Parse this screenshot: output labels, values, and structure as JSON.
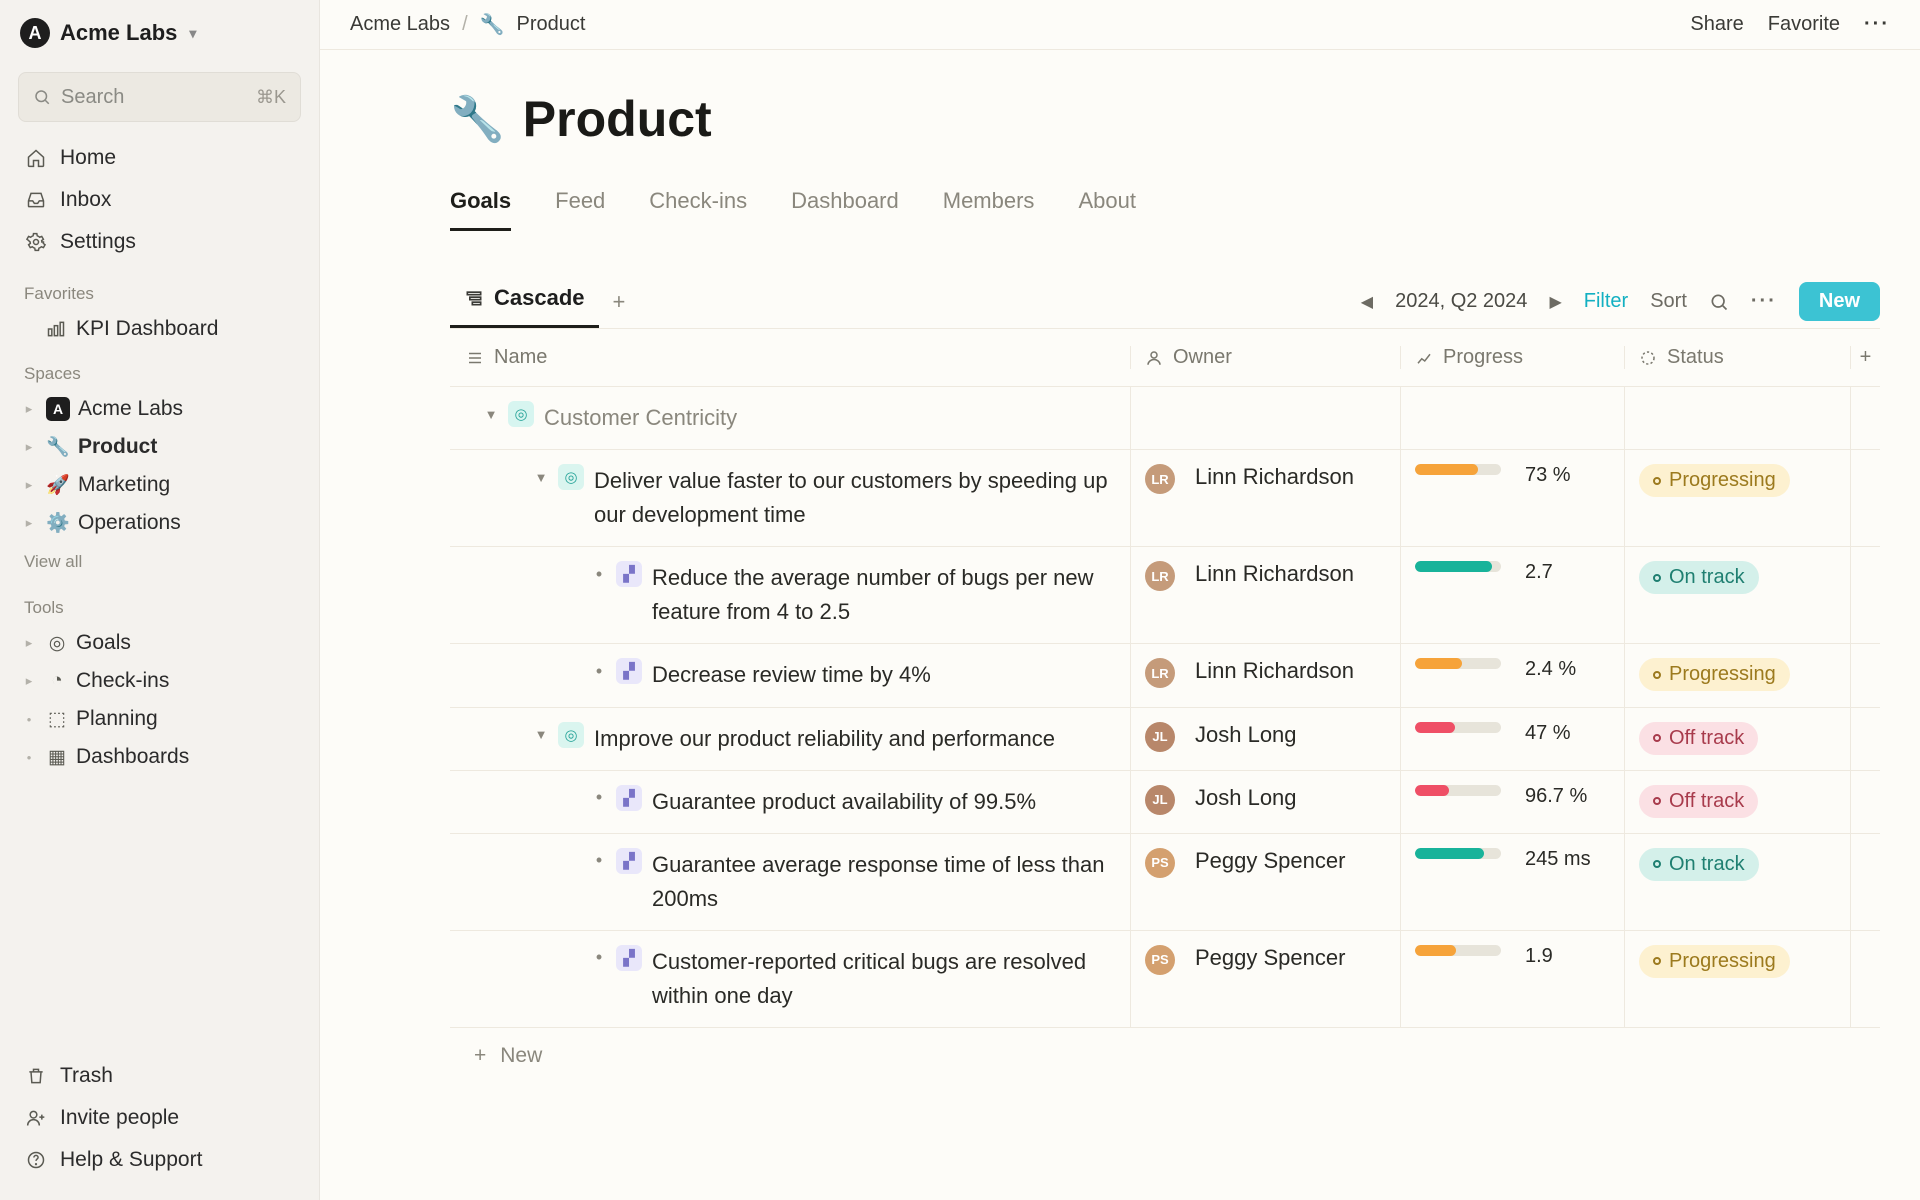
{
  "workspace": {
    "name": "Acme Labs"
  },
  "search": {
    "placeholder": "Search",
    "shortcut": "⌘K"
  },
  "nav": {
    "home": "Home",
    "inbox": "Inbox",
    "settings": "Settings"
  },
  "sections": {
    "favorites": "Favorites",
    "spaces": "Spaces",
    "tools": "Tools"
  },
  "favorites": [
    {
      "label": "KPI Dashboard",
      "icon": "chart"
    }
  ],
  "spaces": [
    {
      "label": "Acme Labs",
      "icon": "logo",
      "bold": false
    },
    {
      "label": "Product",
      "icon": "🔧",
      "bold": true
    },
    {
      "label": "Marketing",
      "icon": "🚀",
      "bold": false
    },
    {
      "label": "Operations",
      "icon": "⚙️",
      "bold": false
    }
  ],
  "viewall": "View all",
  "tools": [
    {
      "label": "Goals",
      "icon": "◎",
      "caret": true
    },
    {
      "label": "Check-ins",
      "icon": "◔",
      "caret": true
    },
    {
      "label": "Planning",
      "icon": "⬚",
      "caret": false
    },
    {
      "label": "Dashboards",
      "icon": "▦",
      "caret": false
    }
  ],
  "bottom": {
    "trash": "Trash",
    "invite": "Invite people",
    "help": "Help & Support"
  },
  "breadcrumb": {
    "root": "Acme Labs",
    "page_icon": "🔧",
    "page": "Product"
  },
  "topbar": {
    "share": "Share",
    "favorite": "Favorite"
  },
  "page": {
    "icon": "🔧",
    "title": "Product"
  },
  "tabs": [
    "Goals",
    "Feed",
    "Check-ins",
    "Dashboard",
    "Members",
    "About"
  ],
  "active_tab": 0,
  "view": {
    "name": "Cascade"
  },
  "toolbar": {
    "period": "2024, Q2 2024",
    "filter": "Filter",
    "sort": "Sort",
    "new": "New"
  },
  "columns": {
    "name": "Name",
    "owner": "Owner",
    "progress": "Progress",
    "status": "Status"
  },
  "statuses": {
    "progressing": "Progressing",
    "ontrack": "On track",
    "offtrack": "Off track"
  },
  "rows": [
    {
      "type": "theme",
      "indent": 0,
      "caret": true,
      "icon": "theme",
      "name": "Customer Centricity"
    },
    {
      "type": "obj",
      "indent": 1,
      "caret": true,
      "icon": "obj",
      "name": "Deliver value faster to our customers by speeding up our development time",
      "owner": {
        "name": "Linn Richardson",
        "av": "av1"
      },
      "progress": {
        "val": "73 %",
        "pct": 73,
        "color": "orange"
      },
      "status": "progressing"
    },
    {
      "type": "kr",
      "indent": 2,
      "icon": "kr",
      "name": "Reduce the average number of bugs per new feature from 4 to 2.5",
      "owner": {
        "name": "Linn Richardson",
        "av": "av1"
      },
      "progress": {
        "val": "2.7",
        "pct": 90,
        "color": "green"
      },
      "status": "ontrack"
    },
    {
      "type": "kr",
      "indent": 2,
      "icon": "kr",
      "name": "Decrease review time by 4%",
      "owner": {
        "name": "Linn Richardson",
        "av": "av1"
      },
      "progress": {
        "val": "2.4 %",
        "pct": 55,
        "color": "orange"
      },
      "status": "progressing"
    },
    {
      "type": "obj",
      "indent": 1,
      "caret": true,
      "icon": "obj",
      "name": "Improve our product reliability and performance",
      "owner": {
        "name": "Josh Long",
        "av": "av2"
      },
      "progress": {
        "val": "47 %",
        "pct": 47,
        "color": "red"
      },
      "status": "offtrack"
    },
    {
      "type": "kr",
      "indent": 2,
      "icon": "kr",
      "name": "Guarantee product availability of 99.5%",
      "owner": {
        "name": "Josh Long",
        "av": "av2"
      },
      "progress": {
        "val": "96.7 %",
        "pct": 40,
        "color": "red"
      },
      "status": "offtrack"
    },
    {
      "type": "kr",
      "indent": 2,
      "icon": "kr",
      "name": "Guarantee average response time of less than 200ms",
      "owner": {
        "name": "Peggy Spencer",
        "av": "av3"
      },
      "progress": {
        "val": "245 ms",
        "pct": 80,
        "color": "green"
      },
      "status": "ontrack"
    },
    {
      "type": "kr",
      "indent": 2,
      "icon": "kr",
      "name": "Customer-reported critical bugs are resolved within one day",
      "owner": {
        "name": "Peggy Spencer",
        "av": "av3"
      },
      "progress": {
        "val": "1.9",
        "pct": 48,
        "color": "orange"
      },
      "status": "progressing"
    }
  ],
  "newrow": "New"
}
